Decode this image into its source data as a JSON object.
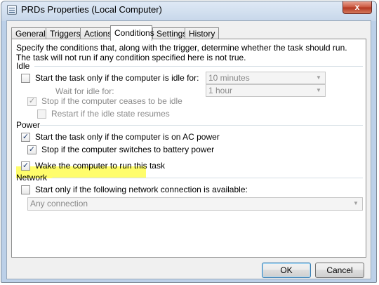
{
  "window": {
    "title": "PRDs Properties (Local Computer)",
    "close_glyph": "x"
  },
  "tabs": [
    {
      "label": "General",
      "active": false
    },
    {
      "label": "Triggers",
      "active": false
    },
    {
      "label": "Actions",
      "active": false
    },
    {
      "label": "Conditions",
      "active": true
    },
    {
      "label": "Settings",
      "active": false
    },
    {
      "label": "History",
      "active": false
    }
  ],
  "description": "Specify the conditions that, along with the trigger, determine whether the task should run.  The task will not run  if any condition specified here is not true.",
  "idle": {
    "header": "Idle",
    "start_if_idle": {
      "label": "Start the task only if the computer is idle for:",
      "checked": false,
      "enabled": true
    },
    "idle_duration": {
      "value": "10 minutes",
      "enabled": false
    },
    "wait_for_idle_label": "Wait for idle for:",
    "wait_duration": {
      "value": "1 hour",
      "enabled": false
    },
    "stop_if_not_idle": {
      "label": "Stop if the computer ceases to be idle",
      "checked": true,
      "enabled": false
    },
    "restart_if_idle": {
      "label": "Restart if the idle state resumes",
      "checked": false,
      "enabled": false
    }
  },
  "power": {
    "header": "Power",
    "ac_power": {
      "label": "Start the task only if the computer is on AC power",
      "checked": true
    },
    "battery_stop": {
      "label": "Stop if the computer switches to battery power",
      "checked": true
    },
    "wake": {
      "label": "Wake the computer to run this task",
      "checked": true,
      "highlighted": true,
      "highlight_color": "#fffd6b"
    }
  },
  "network": {
    "header": "Network",
    "start_if_network": {
      "label": "Start only if the following network connection is available:",
      "checked": false
    },
    "connection": {
      "value": "Any connection",
      "enabled": false
    }
  },
  "buttons": {
    "ok": "OK",
    "cancel": "Cancel"
  },
  "check_glyph": "✓",
  "arrow_glyph": "▼"
}
